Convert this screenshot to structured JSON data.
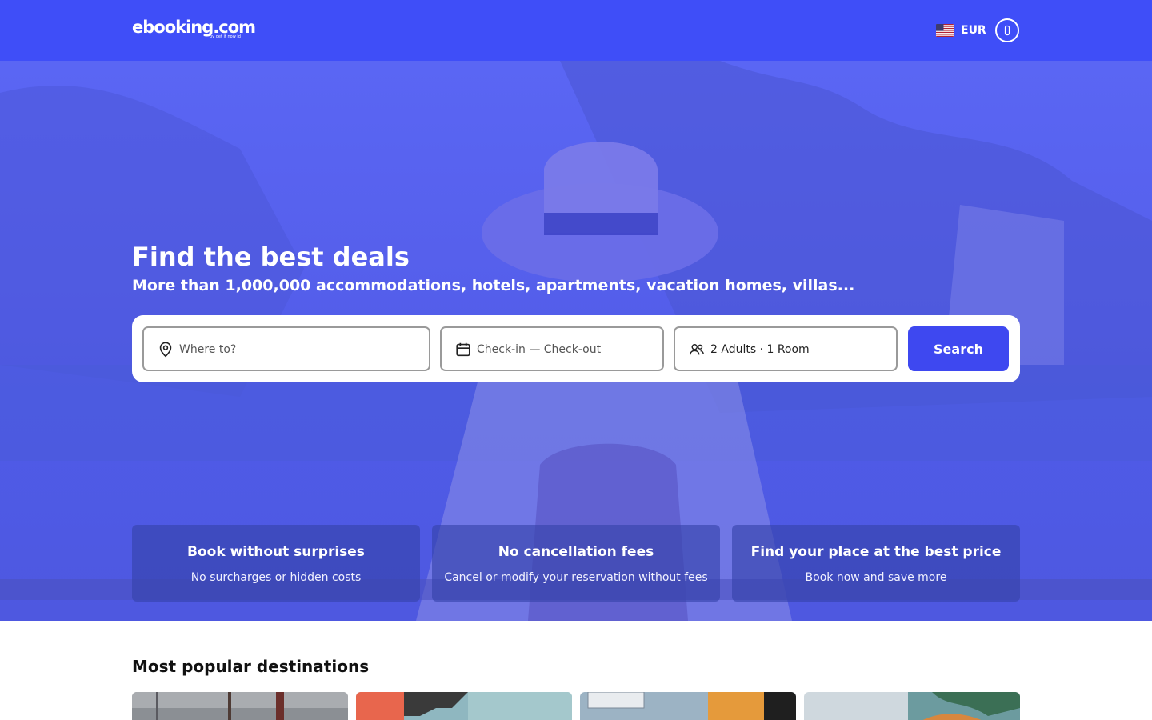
{
  "header": {
    "logo_text": "ebooking.com",
    "logo_tagline": "by get it now id",
    "currency": "EUR",
    "icons": {
      "flag": "us-flag-icon",
      "account": "user-icon"
    }
  },
  "hero": {
    "title": "Find the best deals",
    "subtitle": "More than 1,000,000 accommodations, hotels, apartments, vacation homes, villas...",
    "search": {
      "destination_placeholder": "Where to?",
      "dates_placeholder": "Check-in — Check-out",
      "guests_value": "2 Adults · 1 Room",
      "search_label": "Search",
      "icons": {
        "destination": "map-pin-icon",
        "dates": "calendar-icon",
        "guests": "users-icon"
      }
    },
    "features": [
      {
        "title": "Book without surprises",
        "text": "No surcharges or hidden costs"
      },
      {
        "title": "No cancellation fees",
        "text": "Cancel or modify your reservation without fees"
      },
      {
        "title": "Find your place at the best price",
        "text": "Book now and save more"
      }
    ]
  },
  "popular": {
    "title": "Most popular destinations"
  },
  "colors": {
    "brand": "#3f4ef8",
    "button": "#3e48f0",
    "feature_card": "#3642aa"
  }
}
